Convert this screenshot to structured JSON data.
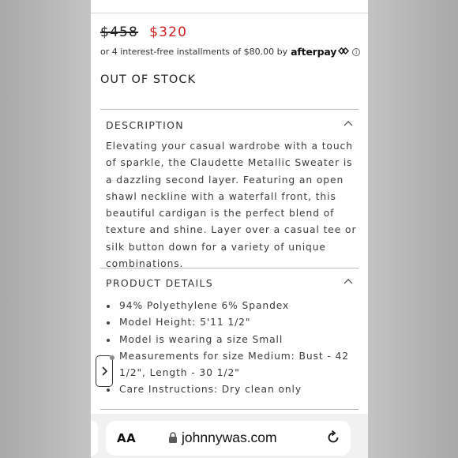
{
  "price": {
    "original": "$458",
    "sale": "$320"
  },
  "afterpay": {
    "text": "or 4 interest-free installments of $80.00 by",
    "brand": "afterpay",
    "info_glyph": "i"
  },
  "stock_status": "OUT OF STOCK",
  "description": {
    "heading": "DESCRIPTION",
    "expanded": true,
    "body": "Elevating your casual wardrobe with a touch of sparkle, the Claudette Metallic Sweater is a dazzling second layer. Featuring an open shawl neckline with a waterfall front, this beautiful cardigan is the perfect blend of texture and shine. Layer over a casual tee or silk button down for a variety of unique combinations."
  },
  "product_details": {
    "heading": "PRODUCT DETAILS",
    "expanded": true,
    "items": [
      "94% Polyethylene 6% Spandex",
      "Model Height: 5'11 1/2\"",
      "Model is wearing a size Small",
      "Measurements for size Medium: Bust - 42 1/2\", Length - 30 1/2\"",
      "Care Instructions: Dry clean only"
    ]
  },
  "browser": {
    "text_size_label": "AA",
    "url": "johnnywas.com",
    "icons": [
      "lock-icon",
      "reload-icon"
    ]
  },
  "colors": {
    "sale_price": "#d11f1f",
    "text": "#3a3a3a",
    "rule": "#b9b9b9",
    "toolbar_bg": "#f1f1f1"
  }
}
